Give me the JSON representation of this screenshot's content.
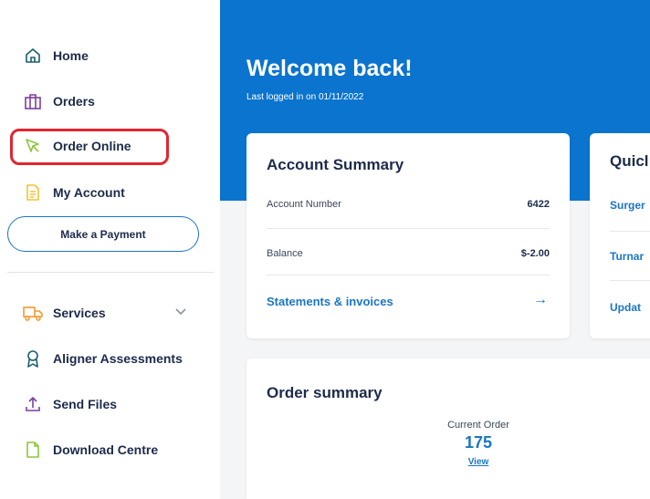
{
  "sidebar": {
    "items": [
      {
        "label": "Home",
        "icon": "home-icon"
      },
      {
        "label": "Orders",
        "icon": "orders-icon"
      },
      {
        "label": "Order Online",
        "icon": "cursor-icon"
      },
      {
        "label": "My Account",
        "icon": "document-icon"
      },
      {
        "label": "Services",
        "icon": "truck-icon"
      },
      {
        "label": "Aligner Assessments",
        "icon": "ribbon-icon"
      },
      {
        "label": "Send Files",
        "icon": "upload-icon"
      },
      {
        "label": "Download Centre",
        "icon": "file-icon"
      }
    ],
    "payment_button": "Make a Payment"
  },
  "header": {
    "welcome": "Welcome back!",
    "last_logged": "Last logged in on 01/11/2022"
  },
  "account_summary": {
    "title": "Account Summary",
    "rows": [
      {
        "label": "Account Number",
        "value": "6422"
      },
      {
        "label": "Balance",
        "value": "$-2.00"
      }
    ],
    "link": "Statements & invoices",
    "arrow": "→"
  },
  "quick_links": {
    "title": "Quicl",
    "links": [
      "Surger",
      "Turnar",
      "Updat"
    ]
  },
  "order_summary": {
    "title": "Order summary",
    "current_label": "Current Order",
    "current_value": "175",
    "view_label": "View"
  },
  "colors": {
    "brand_blue": "#0a74cf",
    "link_blue": "#1b75c4",
    "highlight_red": "#e0262f",
    "nav_text": "#1c2b4a",
    "icon_green": "#8cc63f",
    "icon_yellow": "#f2c230",
    "icon_orange": "#f29a2e",
    "icon_purple": "#7b3fa0",
    "icon_teal": "#1a5e6e"
  }
}
